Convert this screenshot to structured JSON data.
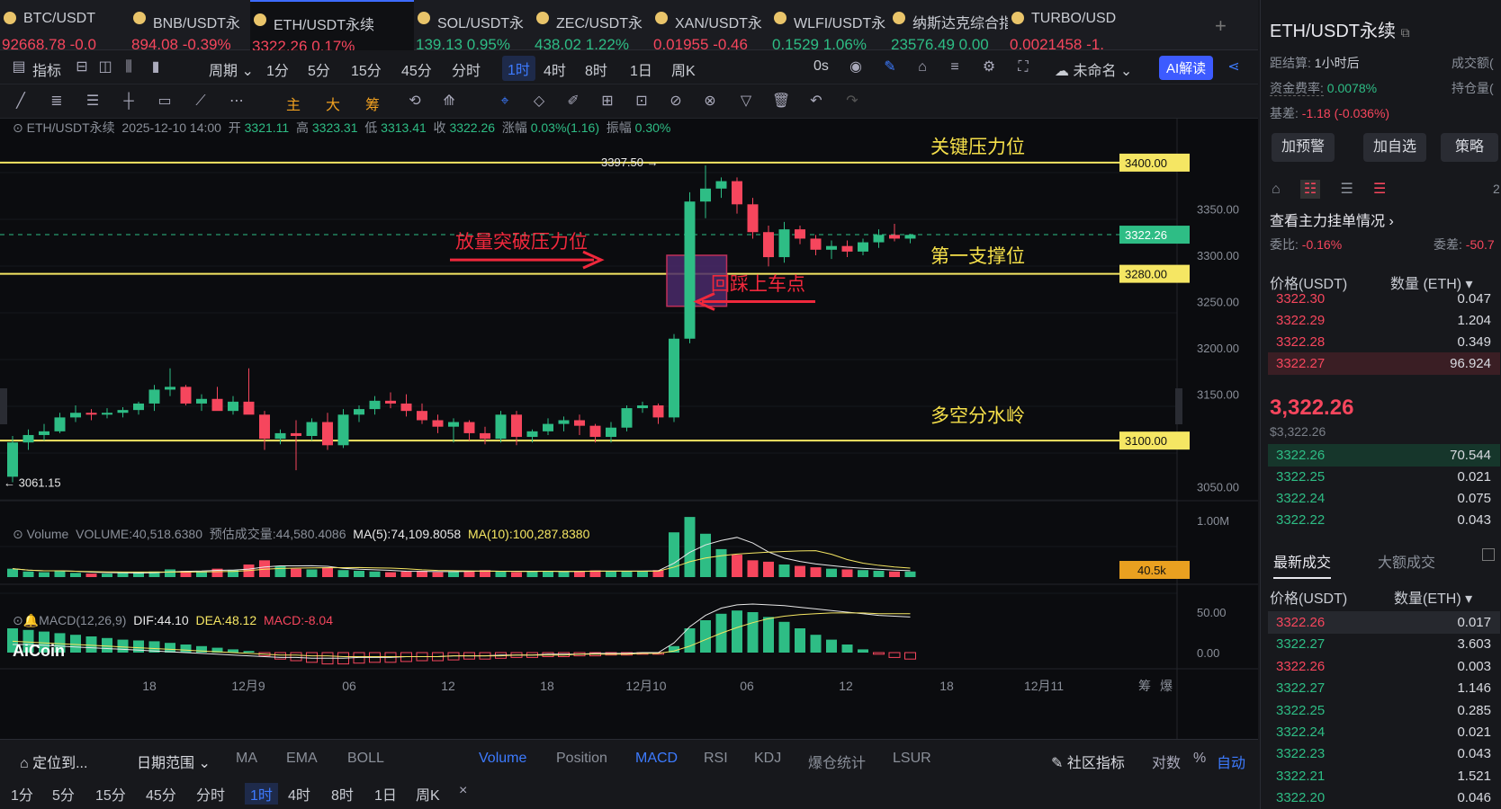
{
  "tabs": [
    {
      "name": "BTC/USDT",
      "price": "92668.78",
      "change": "-0.0",
      "dir": "dn"
    },
    {
      "name": "BNB/USDT永",
      "price": "894.08",
      "change": "-0.39%",
      "dir": "dn"
    },
    {
      "name": "ETH/USDT永续",
      "price": "3322.26",
      "change": "0.17%",
      "dir": "dn",
      "active": true
    },
    {
      "name": "SOL/USDT永",
      "price": "139.13",
      "change": "0.95%",
      "dir": "up"
    },
    {
      "name": "ZEC/USDT永",
      "price": "438.02",
      "change": "1.22%",
      "dir": "up"
    },
    {
      "name": "XAN/USDT永",
      "price": "0.01955",
      "change": "-0.46",
      "dir": "dn"
    },
    {
      "name": "WLFI/USDT永",
      "price": "0.1529",
      "change": "1.06%",
      "dir": "up"
    },
    {
      "name": "纳斯达克综合指数",
      "price": "23576.49",
      "change": "0.00",
      "dir": "up"
    },
    {
      "name": "TURBO/USD",
      "price": "0.0021458",
      "change": "-1.",
      "dir": "dn"
    }
  ],
  "toolbar": {
    "indicator": "指标",
    "period": "周期",
    "intervals": [
      "1分",
      "5分",
      "15分",
      "45分",
      "分时",
      "1时",
      "4时",
      "8时",
      "1日",
      "周K"
    ],
    "selected_interval": "1时",
    "countdown": "0s",
    "layout_name": "未命名",
    "ai_label": "AI解读"
  },
  "drawing_tools": {
    "main": "主",
    "big": "大",
    "chips": "筹"
  },
  "info_line": {
    "symbol": "ETH/USDT永续",
    "datetime": "2025-12-10 14:00",
    "open_label": "开",
    "open": "3321.11",
    "high_label": "高",
    "high": "3323.31",
    "low_label": "低",
    "low": "3313.41",
    "close_label": "收",
    "close": "3322.26",
    "change_label": "涨幅",
    "change": "0.03%(1.16)",
    "amp_label": "振幅",
    "amp": "0.30%"
  },
  "annotations": {
    "key_resistance": "关键压力位",
    "first_support": "第一支撑位",
    "divide": "多空分水岭",
    "breakout": "放量突破压力位",
    "pullback": "回踩上车点",
    "high_mark": "3397.50",
    "low_mark": "3061.15"
  },
  "price_axis": {
    "ticks": [
      "3350.00",
      "3300.00",
      "3250.00",
      "3200.00",
      "3150.00",
      "3050.00"
    ],
    "tags": [
      "3400.00",
      "3322.26",
      "3280.00",
      "3100.00"
    ]
  },
  "volume": {
    "title": "Volume",
    "vol": "VOLUME:40,518.6380",
    "est": "预估成交量:44,580.4086",
    "ma5": "MA(5):74,109.8058",
    "ma10": "MA(10):100,287.8380",
    "axis": "1.00M",
    "tag": "40.5k"
  },
  "macd": {
    "title": "MACD(12,26,9)",
    "dif": "DIF:44.10",
    "dea": "DEA:48.12",
    "macd": "MACD:-8.04",
    "axis1": "50.00",
    "axis2": "0.00"
  },
  "xaxis": [
    "18",
    "12月9",
    "06",
    "12",
    "18",
    "12月10",
    "06",
    "12",
    "18",
    "12月11"
  ],
  "xaxis_right": [
    "筹",
    "爆"
  ],
  "logo": "AiCoin",
  "bottom": {
    "goto": "定位到...",
    "range": "日期范围",
    "indicators": [
      "MA",
      "EMA",
      "BOLL"
    ],
    "sub": [
      "Volume",
      "Position",
      "MACD",
      "RSI",
      "KDJ",
      "爆仓统计",
      "LSUR"
    ],
    "community": "社区指标",
    "log": "对数",
    "pct": "%",
    "auto": "自动",
    "intervals": [
      "1分",
      "5分",
      "15分",
      "45分",
      "分时",
      "1时",
      "4时",
      "8时",
      "1日",
      "周K"
    ],
    "selected": "1时",
    "close": "×"
  },
  "right": {
    "title": "ETH/USDT永续",
    "settle_label": "距结算:",
    "settle": "1小时后",
    "turnover_label": "成交额(",
    "funding_label": "资金费率:",
    "funding": "0.0078%",
    "oi_label": "持仓量(",
    "basis_label": "基差:",
    "basis": "-1.18 (-0.036%)",
    "buttons": [
      "加预警",
      "加自选",
      "策略"
    ],
    "orders_title": "查看主力挂单情况",
    "ratio_label": "委比:",
    "ratio": "-0.16%",
    "diff_label": "委差:",
    "diff": "-50.7",
    "col_price": "价格(USDT)",
    "col_qty": "数量 (ETH)",
    "asks": [
      {
        "p": "3322.30",
        "q": "0.047"
      },
      {
        "p": "3322.29",
        "q": "1.204"
      },
      {
        "p": "3322.28",
        "q": "0.349"
      },
      {
        "p": "3322.27",
        "q": "96.924"
      }
    ],
    "last_price": "3,322.26",
    "last_sub": "$3,322.26",
    "bids": [
      {
        "p": "3322.26",
        "q": "70.544"
      },
      {
        "p": "3322.25",
        "q": "0.021"
      },
      {
        "p": "3322.24",
        "q": "0.075"
      },
      {
        "p": "3322.22",
        "q": "0.043"
      }
    ],
    "trade_tabs": [
      "最新成交",
      "大额成交"
    ],
    "trade_col_price": "价格(USDT)",
    "trade_col_qty": "数量(ETH)",
    "trades": [
      {
        "p": "3322.26",
        "q": "0.017",
        "d": "dn"
      },
      {
        "p": "3322.27",
        "q": "3.603",
        "d": "up"
      },
      {
        "p": "3322.26",
        "q": "0.003",
        "d": "dn"
      },
      {
        "p": "3322.27",
        "q": "1.146",
        "d": "up"
      },
      {
        "p": "3322.25",
        "q": "0.285",
        "d": "up"
      },
      {
        "p": "3322.24",
        "q": "0.021",
        "d": "up"
      },
      {
        "p": "3322.23",
        "q": "0.043",
        "d": "up"
      },
      {
        "p": "3322.21",
        "q": "1.521",
        "d": "up"
      },
      {
        "p": "3322.20",
        "q": "0.046",
        "d": "up"
      }
    ],
    "page_num": "2"
  },
  "colors": {
    "up": "#2ebd85",
    "down": "#f6465d",
    "accent": "#3d7bff",
    "level": "#f5e663",
    "annot": "#f6e04a",
    "red_annot": "#f0283c"
  },
  "candles": [
    [
      3061,
      3105,
      3055,
      3098
    ],
    [
      3098,
      3112,
      3090,
      3106
    ],
    [
      3106,
      3118,
      3100,
      3110
    ],
    [
      3110,
      3130,
      3108,
      3125
    ],
    [
      3125,
      3138,
      3120,
      3130
    ],
    [
      3130,
      3134,
      3122,
      3128
    ],
    [
      3128,
      3135,
      3124,
      3130
    ],
    [
      3130,
      3136,
      3125,
      3133
    ],
    [
      3133,
      3142,
      3128,
      3140
    ],
    [
      3140,
      3160,
      3132,
      3155
    ],
    [
      3155,
      3178,
      3148,
      3158
    ],
    [
      3158,
      3160,
      3138,
      3140
    ],
    [
      3140,
      3150,
      3132,
      3145
    ],
    [
      3145,
      3158,
      3138,
      3132
    ],
    [
      3132,
      3148,
      3128,
      3142
    ],
    [
      3142,
      3178,
      3130,
      3128
    ],
    [
      3128,
      3132,
      3090,
      3102
    ],
    [
      3102,
      3112,
      3096,
      3108
    ],
    [
      3108,
      3122,
      3068,
      3105
    ],
    [
      3105,
      3124,
      3100,
      3120
    ],
    [
      3120,
      3130,
      3090,
      3095
    ],
    [
      3095,
      3134,
      3092,
      3128
    ],
    [
      3128,
      3138,
      3120,
      3134
    ],
    [
      3134,
      3148,
      3128,
      3143
    ],
    [
      3143,
      3152,
      3135,
      3140
    ],
    [
      3140,
      3150,
      3126,
      3132
    ],
    [
      3132,
      3140,
      3118,
      3122
    ],
    [
      3122,
      3128,
      3108,
      3115
    ],
    [
      3115,
      3124,
      3098,
      3120
    ],
    [
      3120,
      3122,
      3100,
      3108
    ],
    [
      3108,
      3115,
      3096,
      3102
    ],
    [
      3102,
      3132,
      3098,
      3128
    ],
    [
      3128,
      3132,
      3095,
      3104
    ],
    [
      3104,
      3112,
      3098,
      3110
    ],
    [
      3110,
      3124,
      3106,
      3118
    ],
    [
      3118,
      3126,
      3110,
      3122
    ],
    [
      3122,
      3128,
      3106,
      3116
    ],
    [
      3116,
      3118,
      3098,
      3104
    ],
    [
      3104,
      3120,
      3098,
      3114
    ],
    [
      3114,
      3138,
      3110,
      3135
    ],
    [
      3135,
      3142,
      3130,
      3138
    ],
    [
      3138,
      3140,
      3118,
      3125
    ],
    [
      3125,
      3215,
      3120,
      3210
    ],
    [
      3210,
      3368,
      3205,
      3358
    ],
    [
      3358,
      3397,
      3340,
      3372
    ],
    [
      3372,
      3384,
      3362,
      3380
    ],
    [
      3380,
      3384,
      3345,
      3355
    ],
    [
      3355,
      3362,
      3318,
      3325
    ],
    [
      3325,
      3332,
      3288,
      3298
    ],
    [
      3298,
      3336,
      3292,
      3328
    ],
    [
      3328,
      3332,
      3312,
      3318
    ],
    [
      3318,
      3322,
      3300,
      3306
    ],
    [
      3306,
      3316,
      3296,
      3310
    ],
    [
      3310,
      3316,
      3298,
      3304
    ],
    [
      3304,
      3318,
      3300,
      3314
    ],
    [
      3314,
      3328,
      3308,
      3322
    ],
    [
      3322,
      3334,
      3315,
      3318
    ],
    [
      3318,
      3323,
      3313,
      3322
    ]
  ],
  "volumes": [
    60,
    40,
    35,
    45,
    30,
    25,
    25,
    30,
    35,
    40,
    55,
    45,
    40,
    60,
    50,
    90,
    120,
    80,
    60,
    55,
    70,
    50,
    45,
    40,
    35,
    40,
    45,
    35,
    40,
    45,
    50,
    40,
    35,
    40,
    45,
    38,
    42,
    48,
    40,
    45,
    42,
    50,
    320,
    430,
    310,
    200,
    160,
    120,
    110,
    90,
    80,
    70,
    60,
    55,
    50,
    45,
    40,
    40
  ],
  "macd_hist": [
    30,
    28,
    26,
    24,
    22,
    20,
    18,
    16,
    15,
    14,
    12,
    10,
    8,
    6,
    4,
    2,
    -4,
    -8,
    -10,
    -12,
    -14,
    -14,
    -13,
    -12,
    -12,
    -11,
    -10,
    -10,
    -9,
    -8,
    -8,
    -7,
    -6,
    -6,
    -5,
    -5,
    -4,
    -4,
    -3,
    -3,
    -2,
    -2,
    8,
    30,
    40,
    48,
    52,
    50,
    44,
    38,
    30,
    22,
    16,
    10,
    4,
    -2,
    -6,
    -8
  ],
  "macd_dif": [
    10,
    10,
    9,
    8,
    7,
    6,
    5,
    4,
    3,
    2,
    1,
    0,
    -1,
    -2,
    -3,
    -4,
    -5,
    -6,
    -6,
    -7,
    -7,
    -7,
    -6,
    -6,
    -6,
    -5,
    -5,
    -5,
    -4,
    -4,
    -4,
    -3,
    -3,
    -3,
    -2,
    -2,
    -2,
    -1,
    -1,
    -1,
    0,
    0,
    12,
    32,
    46,
    55,
    59,
    60,
    59,
    58,
    56,
    54,
    52,
    50,
    48,
    46,
    45,
    44
  ],
  "macd_dea": [
    14,
    13,
    12,
    11,
    10,
    9,
    8,
    7,
    6,
    5,
    4,
    3,
    2,
    1,
    0,
    -1,
    -2,
    -3,
    -3,
    -4,
    -4,
    -5,
    -5,
    -5,
    -5,
    -5,
    -5,
    -5,
    -4,
    -4,
    -4,
    -4,
    -3,
    -3,
    -3,
    -3,
    -2,
    -2,
    -2,
    -2,
    -1,
    -1,
    2,
    8,
    16,
    24,
    31,
    37,
    42,
    45,
    47,
    48,
    49,
    49,
    49,
    48,
    48,
    48
  ]
}
